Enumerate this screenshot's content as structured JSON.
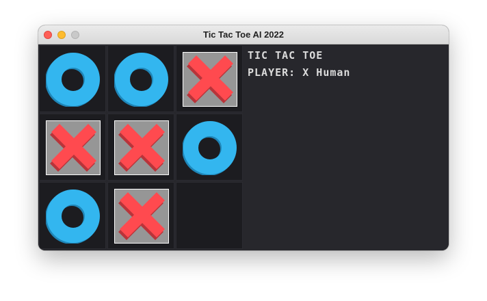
{
  "window": {
    "title": "Tic Tac Toe AI 2022"
  },
  "board": {
    "cells": [
      "O",
      "O",
      "X",
      "X",
      "X",
      "O",
      "O",
      "X",
      ""
    ]
  },
  "info": {
    "heading": "TIC TAC TOE",
    "player_line": "PLAYER: X Human"
  },
  "colors": {
    "o_piece": "#33b6ef",
    "x_piece": "#ff4a4f",
    "x_tile": "#969696",
    "cell_bg": "#1c1c20",
    "panel_bg": "#27272c"
  }
}
